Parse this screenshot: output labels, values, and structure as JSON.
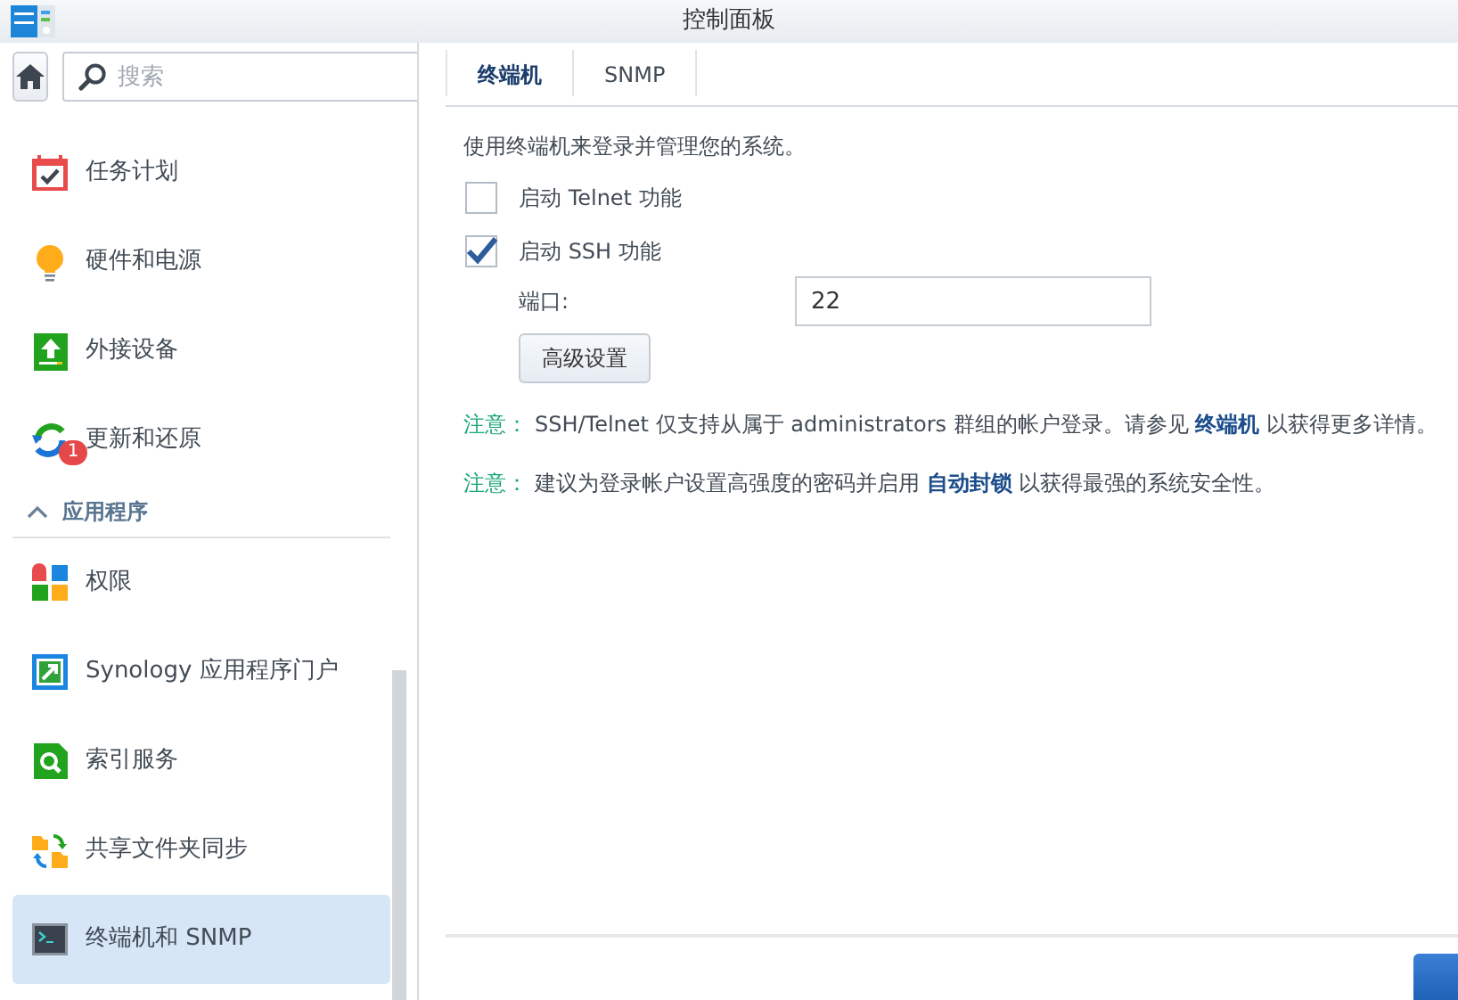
{
  "window": {
    "title": "控制面板"
  },
  "search": {
    "placeholder": "搜索"
  },
  "sidebar": {
    "items": [
      {
        "kind": "item",
        "label": "任务计划",
        "selected": false
      },
      {
        "kind": "item",
        "label": "硬件和电源",
        "selected": false
      },
      {
        "kind": "item",
        "label": "外接设备",
        "selected": false
      },
      {
        "kind": "item",
        "label": "更新和还原",
        "badge": "1",
        "selected": false
      },
      {
        "kind": "section",
        "label": "应用程序",
        "expanded": true
      },
      {
        "kind": "item",
        "label": "权限",
        "selected": false
      },
      {
        "kind": "item",
        "label": "Synology 应用程序门户",
        "selected": false
      },
      {
        "kind": "item",
        "label": "索引服务",
        "selected": false
      },
      {
        "kind": "item",
        "label": "共享文件夹同步",
        "selected": false
      },
      {
        "kind": "item",
        "label": "终端机和 SNMP",
        "selected": true
      }
    ]
  },
  "tabs": [
    {
      "label": "终端机",
      "selected": true
    },
    {
      "label": "SNMP",
      "selected": false
    }
  ],
  "description": "使用终端机来登录并管理您的系统。",
  "options": [
    {
      "label": "启动 Telnet 功能",
      "checked": false
    },
    {
      "label": "启动 SSH 功能",
      "checked": true
    }
  ],
  "port": {
    "label": "端口:",
    "value": "22"
  },
  "advanced_button": "高级设置",
  "notes": [
    {
      "label": "注意：",
      "text": "SSH/Telnet 仅支持从属于 administrators 群组的帐户登录。请参见 ",
      "link": "终端机",
      "after": " 以获得更多详情。"
    },
    {
      "label": "注意：",
      "text": "建议为登录帐户设置高强度的密码并启用 ",
      "link": "自动封锁",
      "after": " 以获得最强的系统安全性。"
    }
  ]
}
